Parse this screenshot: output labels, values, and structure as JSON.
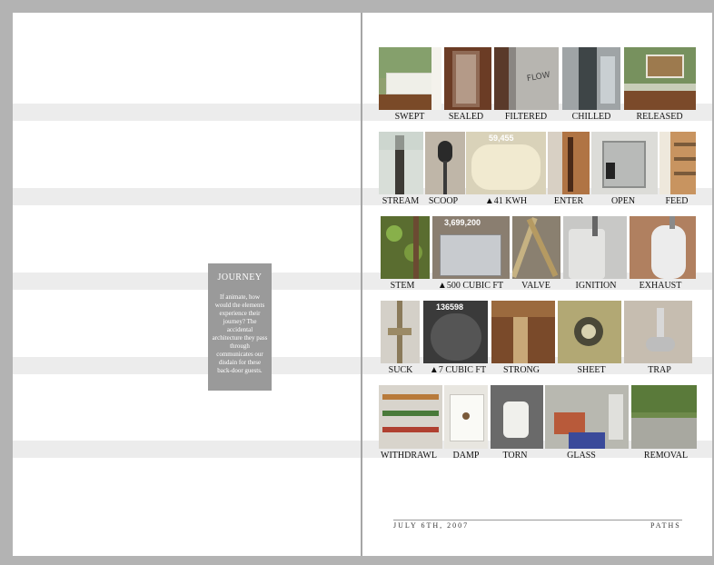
{
  "journey": {
    "title": "JOURNEY",
    "text": "If animate, how would the elements experience their journey? The accidental architecture they pass through communicates our disdain for these back-door guests."
  },
  "rows": [
    {
      "labels": [
        "SWEPT",
        "SEALED",
        "FILTERED",
        "CHILLED",
        "RELEASED"
      ]
    },
    {
      "labels": [
        "STREAM",
        "SCOOP",
        "▲41 KWH",
        "ENTER",
        "OPEN",
        "FEED"
      ]
    },
    {
      "labels": [
        "STEM",
        "▲500 CUBIC FT",
        "VALVE",
        "IGNITION",
        "EXHAUST"
      ]
    },
    {
      "labels": [
        "SUCK",
        "▲7 CUBIC FT",
        "STRONG",
        "SHEET",
        "TRAP"
      ]
    },
    {
      "labels": [
        "WITHDRAWL",
        "DAMP",
        "TORN",
        "GLASS",
        "REMOVAL"
      ]
    }
  ],
  "photo_text": {
    "flow": "FLOW",
    "meter_electric": "59,455",
    "meter_gas": "3,699,200",
    "meter_water": "136598"
  },
  "footer": {
    "date": "JULY 6TH, 2007",
    "title": "PATHS"
  }
}
